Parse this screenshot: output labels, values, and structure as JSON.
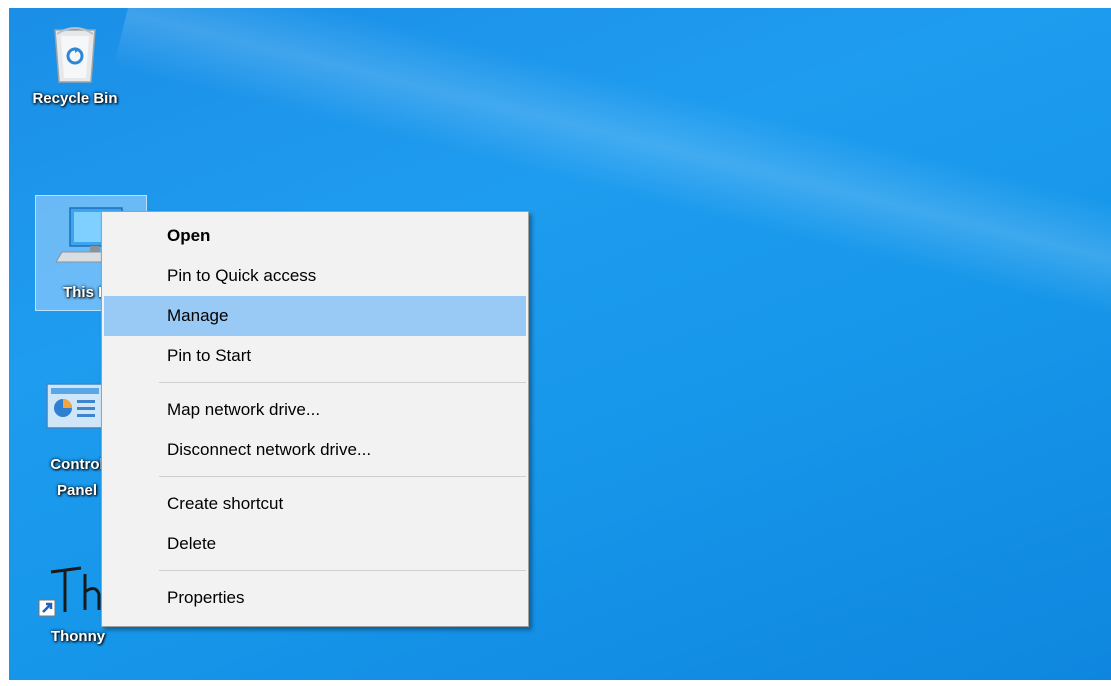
{
  "desktop": {
    "icons": [
      {
        "label": "Recycle Bin"
      },
      {
        "label": "This PC"
      },
      {
        "label": "Control Panel"
      },
      {
        "label": "Thonny"
      }
    ]
  },
  "context_menu": {
    "groups": [
      [
        {
          "label": "Open",
          "bold": true
        },
        {
          "label": "Pin to Quick access"
        },
        {
          "label": "Manage",
          "highlighted": true
        },
        {
          "label": "Pin to Start"
        }
      ],
      [
        {
          "label": "Map network drive..."
        },
        {
          "label": "Disconnect network drive..."
        }
      ],
      [
        {
          "label": "Create shortcut"
        },
        {
          "label": "Delete"
        }
      ],
      [
        {
          "label": "Properties"
        }
      ]
    ]
  },
  "colors": {
    "wallpaper": "#1e9cef",
    "menu_background": "#f2f2f2",
    "menu_highlight": "#99c9f5"
  }
}
